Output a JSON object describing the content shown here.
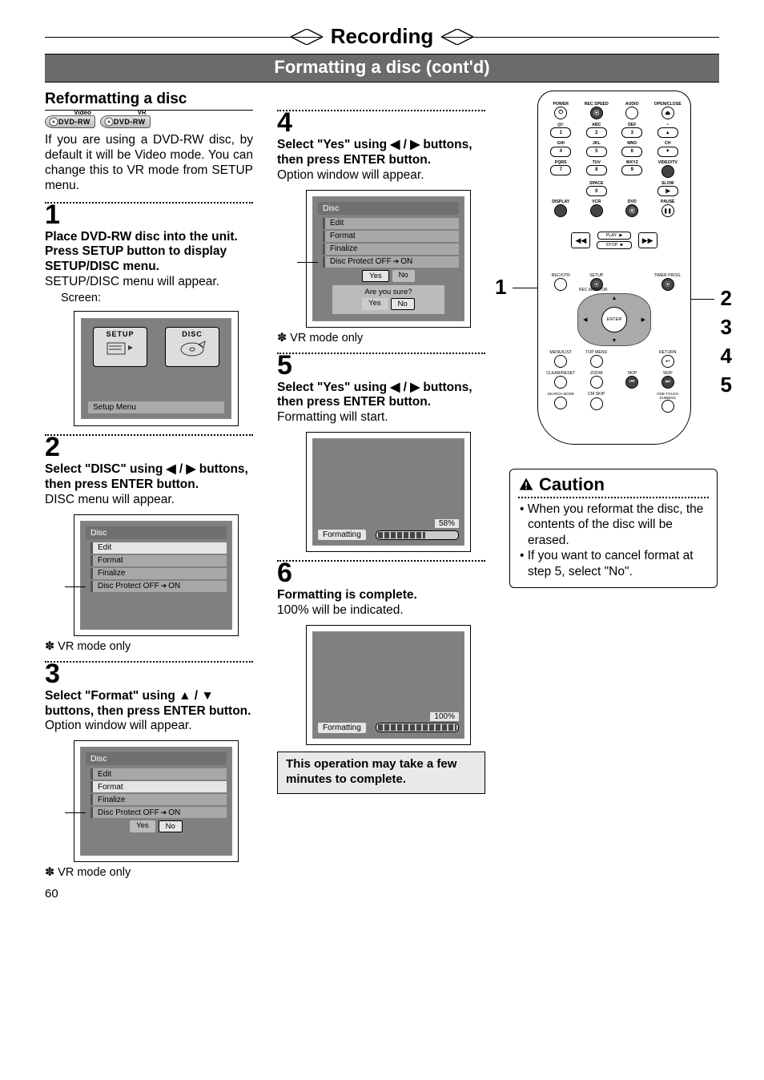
{
  "header": {
    "chapter_title": "Recording",
    "section_title": "Formatting a disc (cont'd)"
  },
  "reformat": {
    "heading": "Reformatting a disc",
    "badges": {
      "video_super": "Video",
      "video_text": "DVD-RW",
      "vr_super": "VR",
      "vr_text": "DVD-RW"
    },
    "intro": "If you are using a DVD-RW disc, by default it will be Video mode. You can change this to VR mode from SETUP menu."
  },
  "steps": {
    "s1": {
      "num": "1",
      "bold_a": "Place DVD-RW disc into the unit.",
      "bold_b": "Press SETUP button to display SETUP/DISC menu.",
      "text": "SETUP/DISC menu will appear.",
      "screen_label": "Screen:",
      "setup_chip": "SETUP",
      "disc_chip": "DISC",
      "setup_footer": "Setup Menu"
    },
    "s2": {
      "num": "2",
      "bold_pre": "Select \"DISC\" using ",
      "bold_sep": " / ",
      "bold_post": " buttons, then press ENTER button.",
      "text": "DISC menu will appear.",
      "foot": "✽ VR mode only"
    },
    "s3": {
      "num": "3",
      "bold_pre": "Select \"Format\" using ",
      "bold_sep": " / ",
      "bold_post": " buttons, then press ENTER button.",
      "text": "Option window will appear.",
      "prompt_yes": "Yes",
      "prompt_no": "No",
      "foot": "✽ VR mode only"
    },
    "s4": {
      "num": "4",
      "bold_pre": "Select \"Yes\" using ",
      "bold_sep": " / ",
      "bold_post": " buttons, then press ENTER button.",
      "text": "Option window will appear.",
      "prompt_yes": "Yes",
      "prompt_no": "No",
      "sure_text": "Are you sure?",
      "sure_yes": "Yes",
      "sure_no": "No",
      "foot": "✽ VR mode only"
    },
    "s5": {
      "num": "5",
      "bold_pre": "Select \"Yes\" using ",
      "bold_sep": " / ",
      "bold_post": " buttons, then press ENTER button.",
      "text": "Formatting will start.",
      "fmt_label": "Formatting",
      "pct": "58%"
    },
    "s6": {
      "num": "6",
      "bold": "Formatting is complete.",
      "text": "100% will be indicated.",
      "fmt_label": "Formatting",
      "pct": "100%"
    },
    "note": "This operation may take a few minutes to complete."
  },
  "osd_menu": {
    "title": "Disc",
    "items": [
      "Edit",
      "Format",
      "Finalize"
    ],
    "protect_label_pre": "Disc Protect OFF",
    "protect_label_post": "ON"
  },
  "arrows": {
    "left": "◀",
    "right": "▶",
    "up": "▲",
    "down": "▼",
    "to": "➔"
  },
  "remote": {
    "labels": {
      "power": "POWER",
      "rec_speed": "REC SPEED",
      "audio": "AUDIO",
      "open_close": "OPEN/CLOSE",
      "at": "@!:",
      "abc": "ABC",
      "def": "DEF",
      "dot": "•",
      "ghi": "GHI",
      "jkl": "JKL",
      "mno": "MNO",
      "ch": "CH",
      "pqrs": "PQRS",
      "tuv": "TUV",
      "wxyz": "WXYZ",
      "video_tv": "VIDEO/TV",
      "space": "SPACE",
      "slow": "SLOW",
      "display": "DISPLAY",
      "vcr": "VCR",
      "dvd": "DVD",
      "pause": "PAUSE",
      "play": "PLAY",
      "stop": "STOP",
      "rew": "◀◀",
      "ffwd": "▶▶",
      "rec_otr": "REC/OTR",
      "setup": "SETUP",
      "timer_prog": "TIMER PROG.",
      "rec_monitor": "REC MONITOR",
      "enter": "ENTER",
      "menu_list": "MENU/LIST",
      "top_menu": "TOP MENU",
      "return": "RETURN",
      "clear_reset": "CLEAR/RESET",
      "zoom": "ZOOM",
      "skip": "SKIP",
      "skip2": "SKIP",
      "search_mode": "SEARCH MODE",
      "cm_skip": "CM SKIP",
      "one_touch": "ONE-TOUCH DUBBING"
    },
    "digits": {
      "d1": "1",
      "d2": "2",
      "d3": "3",
      "d4": "4",
      "d5": "5",
      "d6": "6",
      "d7": "7",
      "d8": "8",
      "d9": "9",
      "d0": "0"
    },
    "callouts": {
      "c1": "1",
      "c2": "2",
      "c3": "3",
      "c4": "4",
      "c5": "5"
    }
  },
  "caution": {
    "title": "Caution",
    "items": [
      "• When you reformat the disc, the contents of the disc will be erased.",
      "• If you want to cancel format at step 5, select \"No\"."
    ]
  },
  "page_number": "60"
}
